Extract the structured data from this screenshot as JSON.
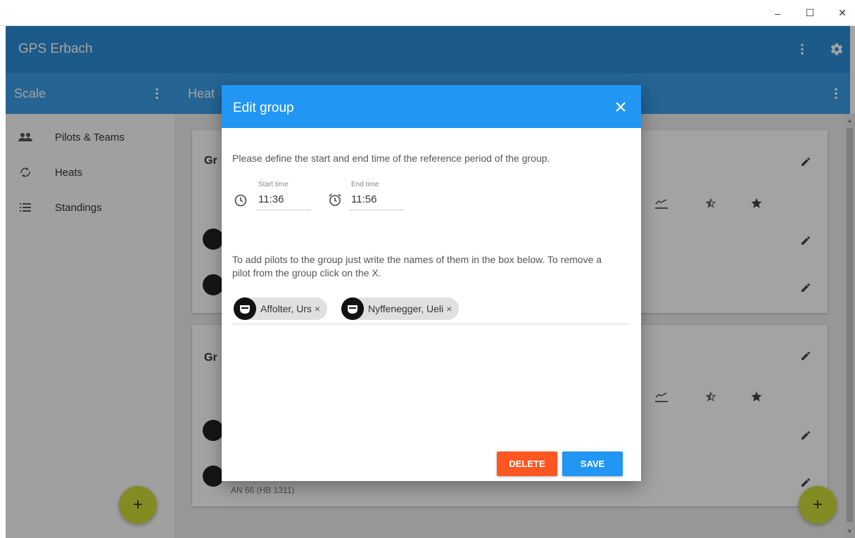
{
  "window": {
    "minimize": "–",
    "maximize": "☐",
    "close": "✕"
  },
  "appbar": {
    "title": "GPS Erbach"
  },
  "subbar": {
    "left_title": "Scale",
    "right_title": "Heat"
  },
  "sidebar": {
    "items": [
      {
        "label": "Pilots & Teams",
        "icon": "people-icon"
      },
      {
        "label": "Heats",
        "icon": "heats-icon"
      },
      {
        "label": "Standings",
        "icon": "list-icon"
      }
    ]
  },
  "main": {
    "cards": [
      {
        "title": "Gr"
      },
      {
        "title": "Gr",
        "pilot_sub": "AN 66 (HB 1311)"
      }
    ]
  },
  "dialog": {
    "title": "Edit group",
    "intro_text": "Please define the start and end time of the reference period of the group.",
    "start_time_label": "Start time",
    "start_time_value": "11:36",
    "end_time_label": "End time",
    "end_time_value": "11:56",
    "pilots_text": "To add pilots to the group just write the names of them in the box below. To remove a pilot from the group click on the X.",
    "chips": [
      {
        "label": "Affolter, Urs",
        "remove": "×"
      },
      {
        "label": "Nyffenegger, Ueli",
        "remove": "×"
      }
    ],
    "delete_label": "DELETE",
    "save_label": "SAVE"
  },
  "fab": {
    "label": "+"
  },
  "colors": {
    "appbar": "#2d8ed8",
    "subbar": "#3a9de6",
    "dialog_header": "#2196f3",
    "delete": "#ff5722",
    "save": "#2196f3",
    "fab": "#cddc39"
  }
}
